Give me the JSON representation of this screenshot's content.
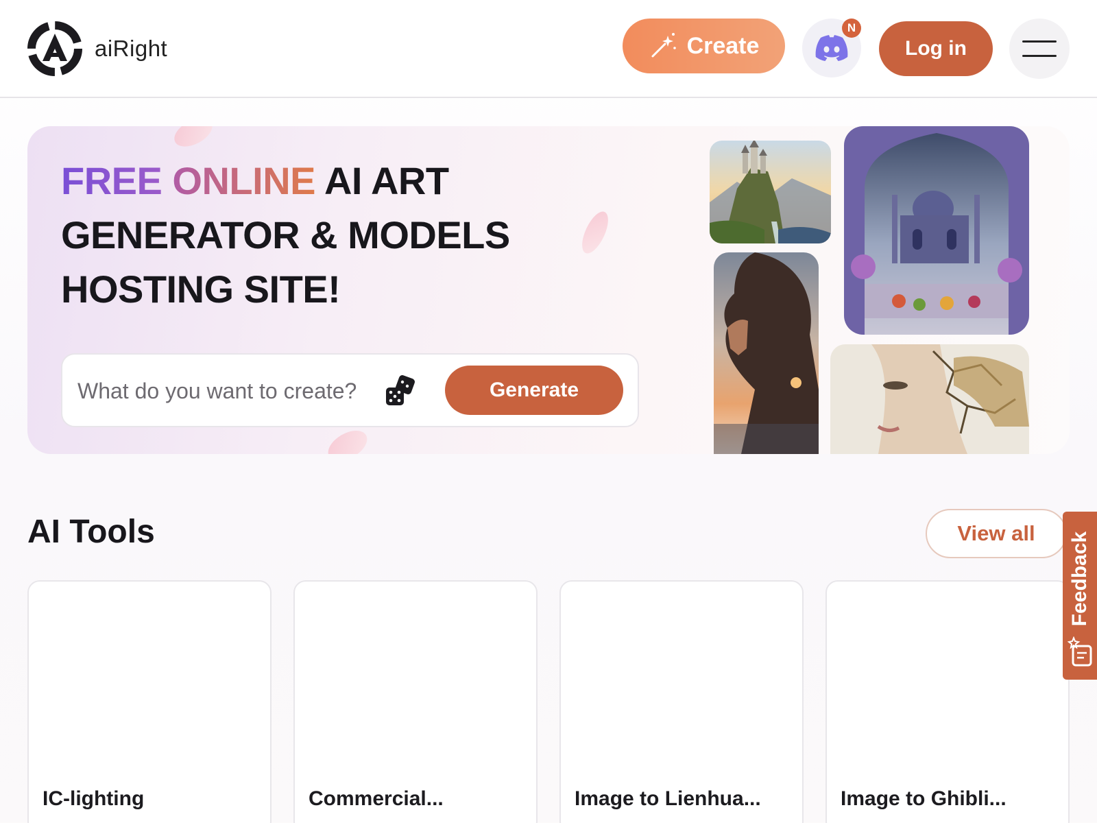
{
  "header": {
    "brand": "aiRight",
    "create_label": "Create",
    "discord_badge": "N",
    "login_label": "Log in",
    "icons": {
      "logo": "airight-logo-icon",
      "create": "magic-wand-icon",
      "discord": "discord-icon",
      "menu": "hamburger-menu-icon"
    }
  },
  "hero": {
    "title_free": "FREE",
    "title_online": "ONLINE",
    "title_rest": "AI ART GENERATOR & MODELS HOSTING SITE!",
    "prompt_placeholder": "What do you want to create?",
    "generate_label": "Generate",
    "images": [
      "castle-landscape",
      "palace-in-archway",
      "woman-sunset-silhouette",
      "cracked-marble-face"
    ]
  },
  "tools": {
    "title": "AI Tools",
    "view_all_label": "View all",
    "cards": [
      {
        "title": "IC-lighting"
      },
      {
        "title": "Commercial..."
      },
      {
        "title": "Image to Lienhua..."
      },
      {
        "title": "Image to Ghibli..."
      }
    ]
  },
  "feedback": {
    "label": "Feedback",
    "icon": "feedback-note-icon"
  },
  "colors": {
    "primary": "#c8623e",
    "create_gradient_start": "#f28c5c",
    "create_gradient_end": "#f2a277",
    "discord": "#7d73e8",
    "free_gradient": "#7a4fd6",
    "online_gradient": "#df7a4a"
  }
}
